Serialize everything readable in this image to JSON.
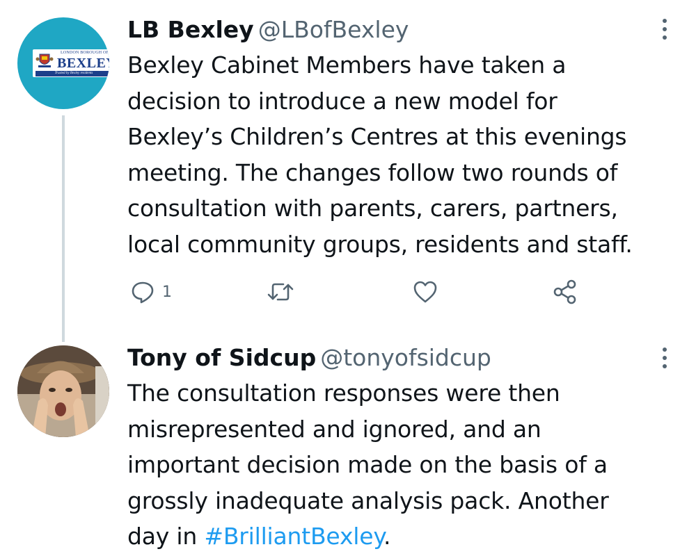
{
  "colors": {
    "avatar_bg": "#1fa7c4",
    "thread_line": "#cfd9de",
    "hashtag": "#1d9bf0",
    "muted": "#536471"
  },
  "tweets": [
    {
      "name": "LB Bexley",
      "handle": "@LBofBexley",
      "avatar": {
        "type": "logo",
        "small_text": "LONDON BOROUGH OF",
        "word": "BEXLEY",
        "tagline": "Trusted by Bexley residents"
      },
      "lines": [
        "Bexley Cabinet Members have taken a",
        "decision to introduce a new model for",
        "Bexley’s Children’s Centres at this evenings",
        "meeting. The changes follow two rounds of",
        "consultation with parents, carers, partners,",
        "local community groups, residents and staff."
      ],
      "actions": {
        "reply_icon": "reply-icon",
        "reply_count": "1",
        "retweet_icon": "retweet-icon",
        "like_icon": "heart-icon",
        "share_icon": "share-icon"
      }
    },
    {
      "name": "Tony of Sidcup",
      "handle": "@tonyofsidcup",
      "avatar": {
        "type": "photo"
      },
      "lines": [
        "The consultation responses were then",
        "misrepresented and ignored, and an",
        "important decision made on the basis of a",
        "grossly inadequate analysis pack. Another"
      ],
      "last_line_prefix": "day in ",
      "hashtag": "#BrilliantBexley",
      "last_line_suffix": "."
    }
  ]
}
